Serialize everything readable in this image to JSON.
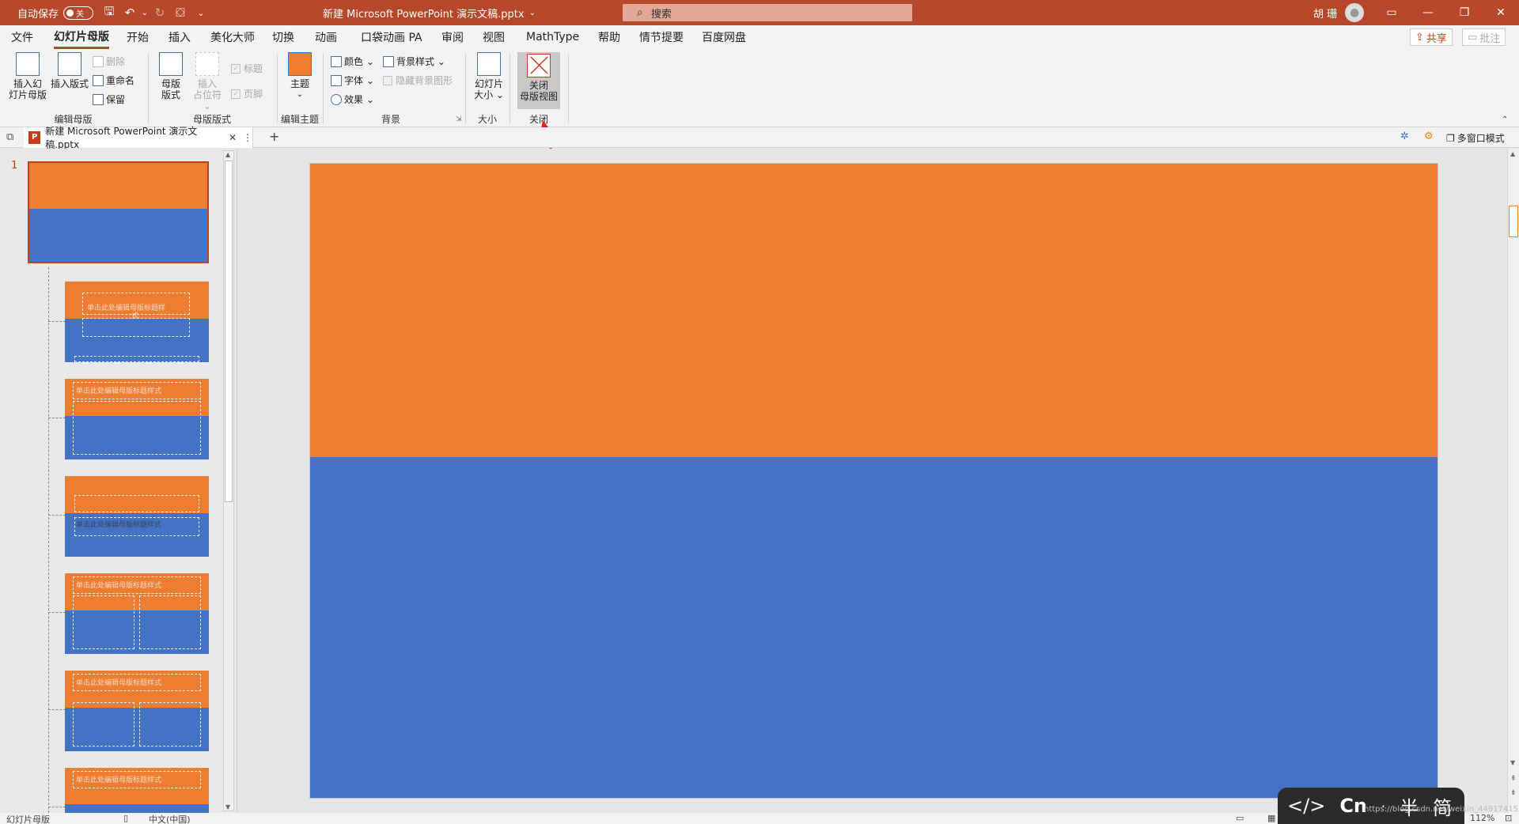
{
  "titlebar": {
    "autosave_label": "自动保存",
    "autosave_state": "关",
    "doc_title": "新建 Microsoft PowerPoint 演示文稿.pptx",
    "doc_title_chevron": "⌄",
    "search_placeholder": "搜索",
    "user_name": "胡 珊",
    "brand_color": "#b7472a"
  },
  "menu": {
    "tabs": [
      "文件",
      "幻灯片母版",
      "开始",
      "插入",
      "美化大师",
      "切换",
      "动画",
      "口袋动画 PA",
      "审阅",
      "视图",
      "MathType",
      "帮助",
      "情节提要",
      "百度网盘"
    ],
    "active_tab": "幻灯片母版",
    "share_label": "共享",
    "comment_label": "批注"
  },
  "ribbon": {
    "groups": {
      "edit_master": "编辑母版",
      "master_layout": "母版版式",
      "edit_theme": "编辑主题",
      "background": "背景",
      "size": "大小",
      "close": "关闭"
    },
    "insert_slide_master_1": "插入幻",
    "insert_slide_master_2": "灯片母版",
    "insert_layout": "插入版式",
    "delete": "删除",
    "rename": "重命名",
    "preserve": "保留",
    "master_layout_1": "母版",
    "master_layout_2": "版式",
    "insert_placeholder_1": "插入",
    "insert_placeholder_2": "占位符 ⌄",
    "title_check": "标题",
    "footer_check": "页脚",
    "theme_label": "主题",
    "theme_chevron": "⌄",
    "colors": "颜色 ⌄",
    "fonts": "字体 ⌄",
    "effects": "效果 ⌄",
    "bg_styles": "背景样式 ⌄",
    "hide_bg": "隐藏背景图形",
    "slide_size_1": "幻灯片",
    "slide_size_2": "大小 ⌄",
    "close_master_1": "关闭",
    "close_master_2": "母版视图"
  },
  "docbar": {
    "tab_title": "新建 Microsoft PowerPoint 演示文稿.pptx",
    "multi_window": "多窗口模式"
  },
  "thumbs": {
    "slide_number": "1",
    "title_text": "单击此处编辑母版标题样式",
    "title_text_wrapped": "单击此处编辑母版标题样",
    "title_text_tail": "式"
  },
  "status": {
    "mode": "幻灯片母版",
    "language": "中文(中国)",
    "zoom": "112%"
  },
  "overlay": {
    "code_glyph": "</>",
    "cn": "Cn",
    "dot": "·",
    "half": "半",
    "simplified": "简",
    "watermark": "https://blog.csdn.net/weixin_44917415"
  },
  "colors": {
    "accent": "#b7472a",
    "slide_orange": "#ed7d31",
    "slide_blue": "#4472c4"
  }
}
